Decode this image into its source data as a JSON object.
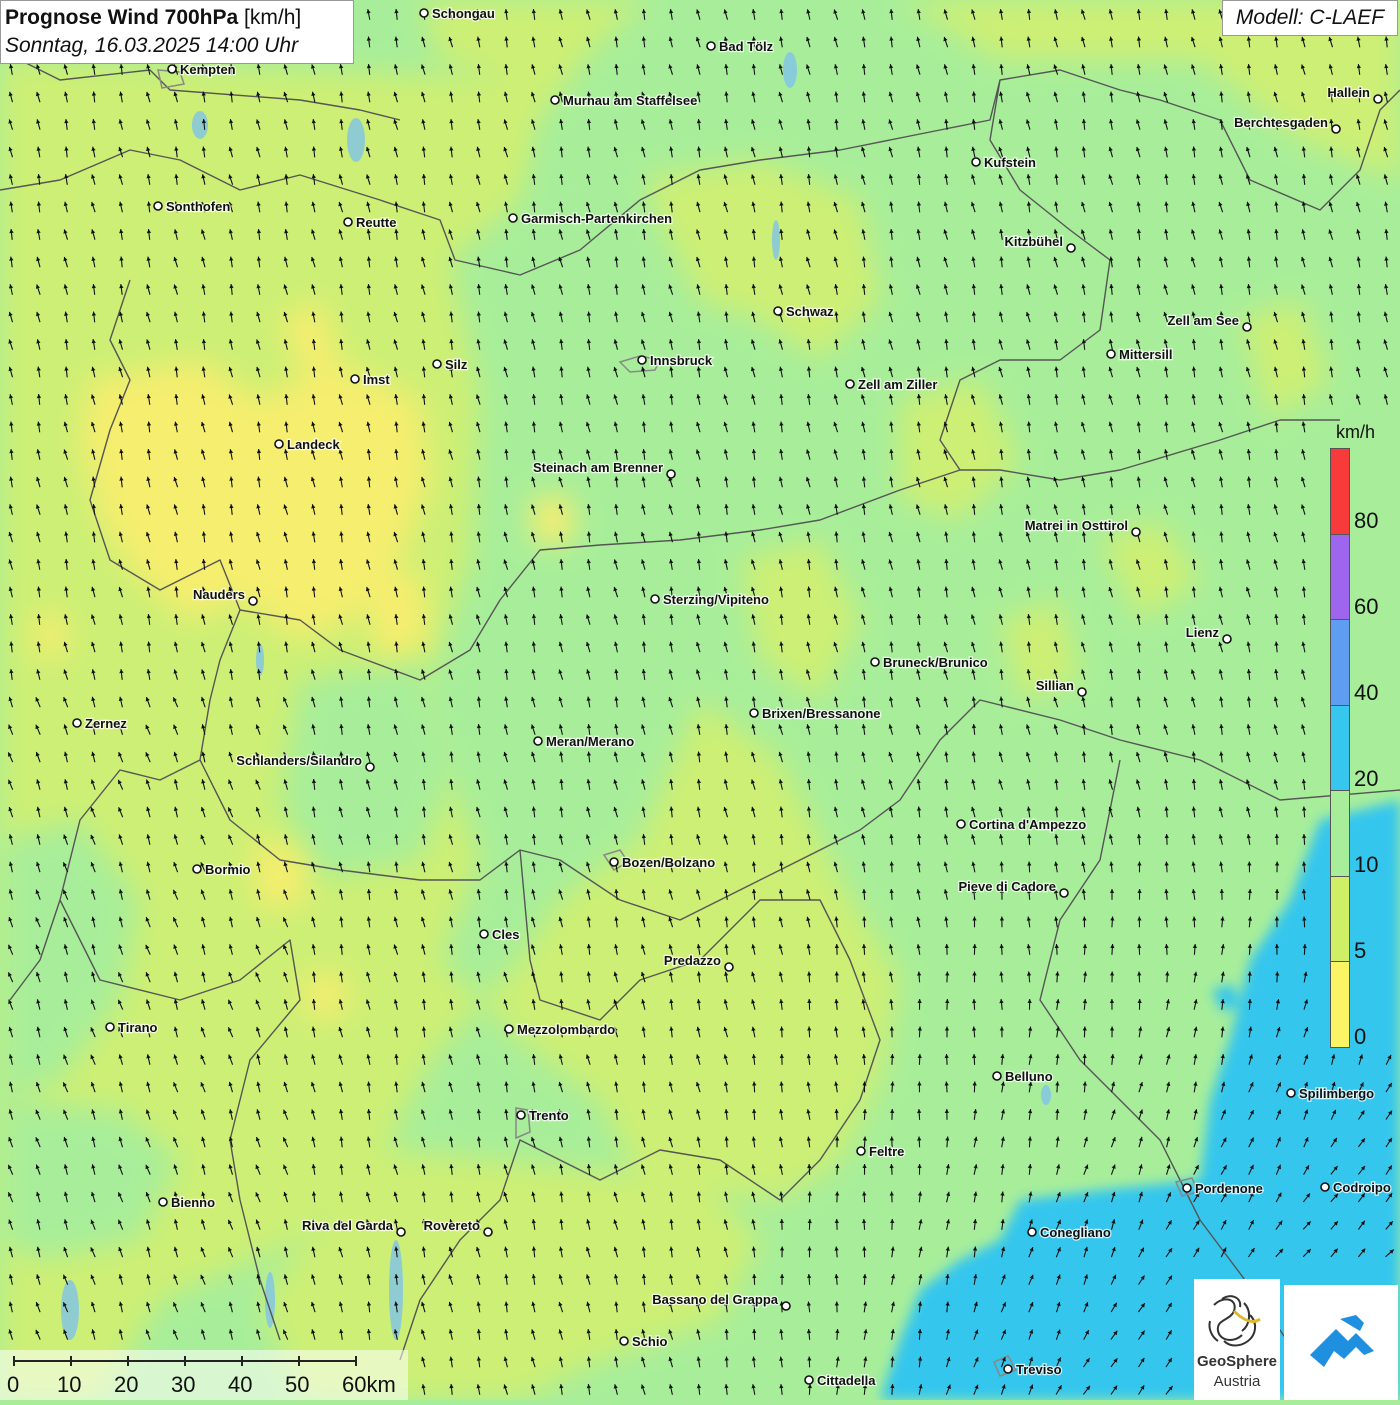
{
  "header": {
    "title_bold": "Prognose Wind 700hPa",
    "title_unit": "[km/h]",
    "subtitle": "Sonntag, 16.03.2025 14:00 Uhr"
  },
  "model_label": "Modell: C-LAEF",
  "legend": {
    "unit": "km/h",
    "ticks": [
      "80",
      "60",
      "40",
      "20",
      "10",
      "5",
      "0"
    ],
    "colors": [
      "#f83a3a",
      "#9e66ee",
      "#5e9df0",
      "#36c6ee",
      "#a8ee9a",
      "#cff066",
      "#fbf464"
    ]
  },
  "map_colors": {
    "calm_yellow": "#f5ee6e",
    "light_green_yellow": "#cdef74",
    "green": "#a8ee9a",
    "light_blue": "#36c6ee",
    "border": "#555555",
    "lakes": "#7fc3e8"
  },
  "wind_arrows": {
    "direction": "predominantly from south to north, turning north-east toward the south-east",
    "color": "#111111"
  },
  "cities": [
    {
      "name": "Schongau"
    },
    {
      "name": "Bad Tölz"
    },
    {
      "name": "Kempten"
    },
    {
      "name": "Murnau am Staffelsee"
    },
    {
      "name": "Hallein"
    },
    {
      "name": "Berchtesgaden"
    },
    {
      "name": "Kufstein"
    },
    {
      "name": "Sonthofen"
    },
    {
      "name": "Reutte"
    },
    {
      "name": "Garmisch-Partenkirchen"
    },
    {
      "name": "Kitzbühel"
    },
    {
      "name": "Schwaz"
    },
    {
      "name": "Zell am See"
    },
    {
      "name": "Mittersill"
    },
    {
      "name": "Innsbruck"
    },
    {
      "name": "Silz"
    },
    {
      "name": "Imst"
    },
    {
      "name": "Zell am Ziller"
    },
    {
      "name": "Landeck"
    },
    {
      "name": "Steinach am Brenner"
    },
    {
      "name": "Matrei in Osttirol"
    },
    {
      "name": "Nauders"
    },
    {
      "name": "Sterzing/Vipiteno"
    },
    {
      "name": "Lienz"
    },
    {
      "name": "Bruneck/Brunico"
    },
    {
      "name": "Sillian"
    },
    {
      "name": "Brixen/Bressanone"
    },
    {
      "name": "Zernez"
    },
    {
      "name": "Meran/Merano"
    },
    {
      "name": "Schlanders/Silandro"
    },
    {
      "name": "Cortina d'Ampezzo"
    },
    {
      "name": "Bozen/Bolzano"
    },
    {
      "name": "Bormio"
    },
    {
      "name": "Pieve di Cadore"
    },
    {
      "name": "Cles"
    },
    {
      "name": "Predazzo"
    },
    {
      "name": "Tirano"
    },
    {
      "name": "Mezzolombardo"
    },
    {
      "name": "Belluno"
    },
    {
      "name": "Spilimbergo"
    },
    {
      "name": "Trento"
    },
    {
      "name": "Feltre"
    },
    {
      "name": "Pordenone"
    },
    {
      "name": "Codroipo"
    },
    {
      "name": "Bienno"
    },
    {
      "name": "Riva del Garda"
    },
    {
      "name": "Rovereto"
    },
    {
      "name": "Conegliano"
    },
    {
      "name": "Bassano del Grappa"
    },
    {
      "name": "Schio"
    },
    {
      "name": "Treviso"
    },
    {
      "name": "Cittadella"
    }
  ],
  "scale": {
    "labels": [
      "0",
      "10",
      "20",
      "30",
      "40",
      "50",
      "60km"
    ]
  },
  "logos": {
    "geosphere_name": "GeoSphere",
    "geosphere_country": "Austria",
    "app_logo_icon": "mountain-arrow-icon"
  }
}
